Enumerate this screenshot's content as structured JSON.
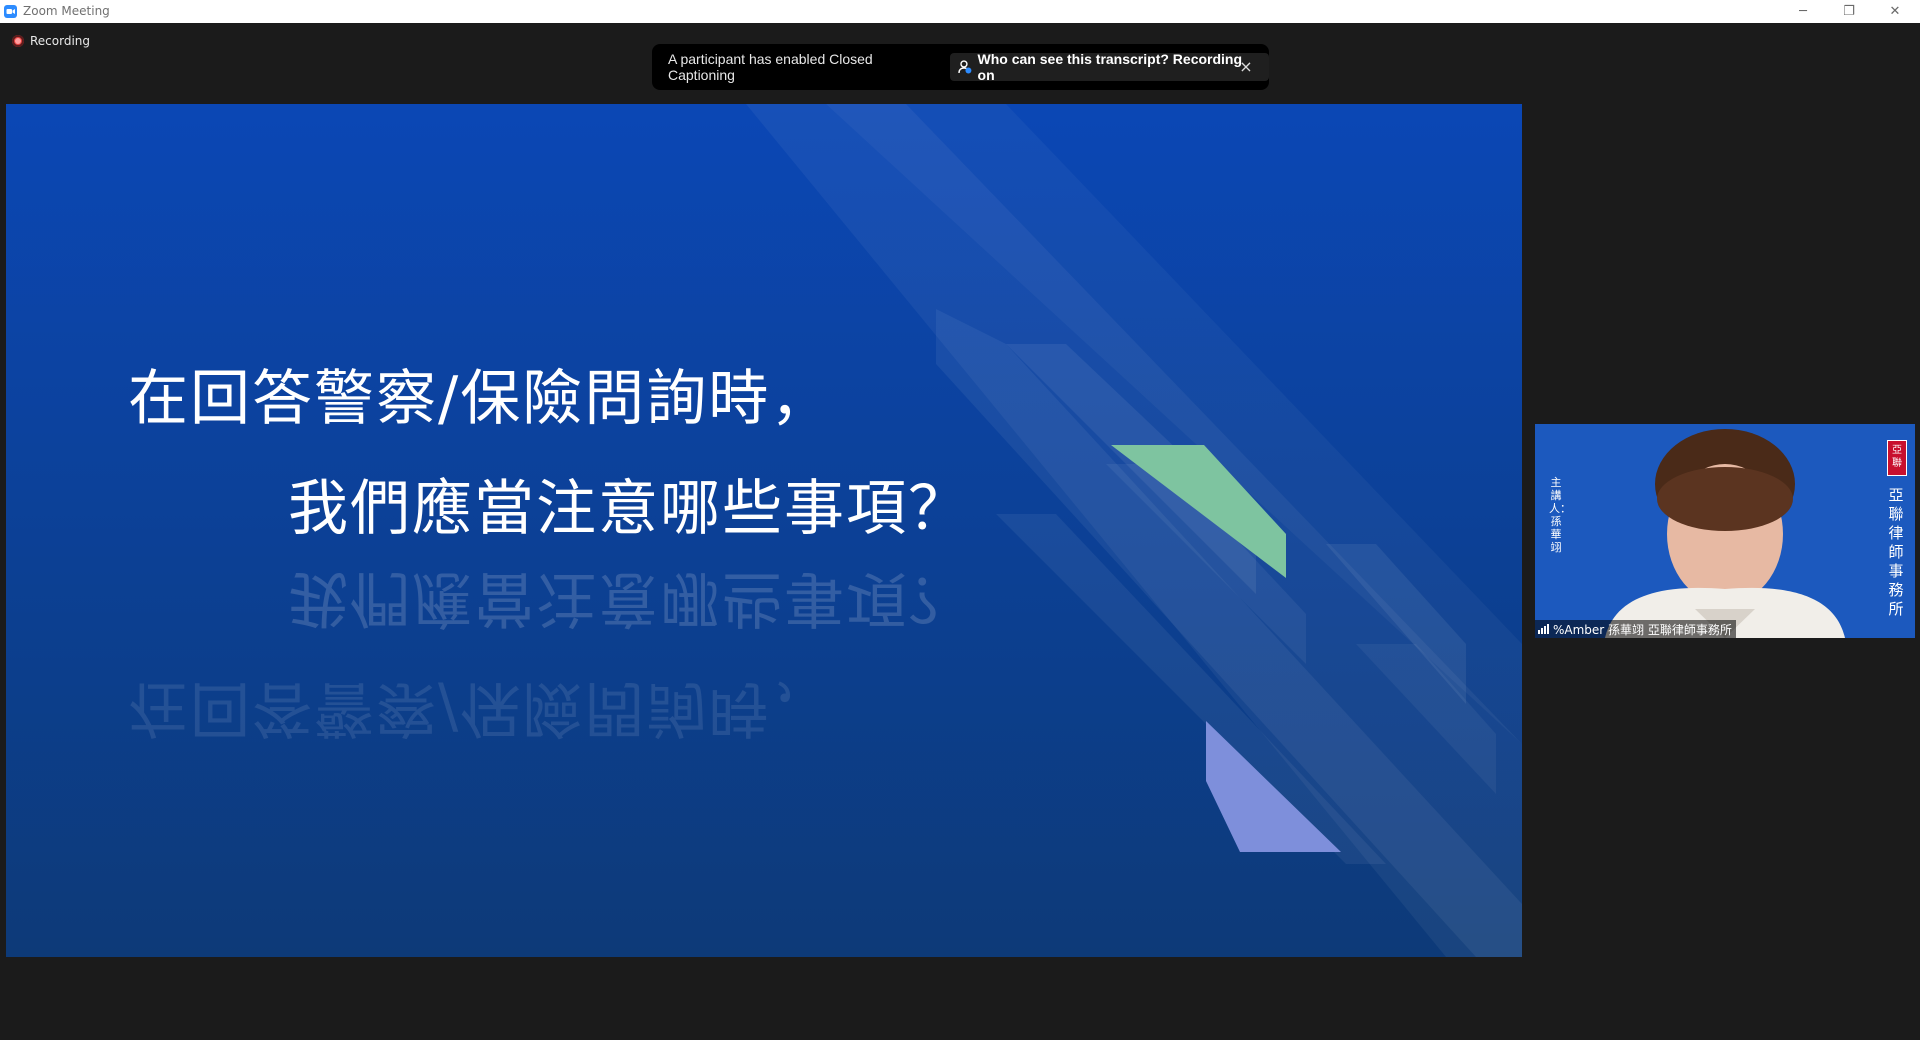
{
  "window": {
    "title": "Zoom Meeting",
    "minimize": "─",
    "restore": "❐",
    "close": "✕"
  },
  "recording": {
    "label": "Recording"
  },
  "banner": {
    "text": "A participant has enabled Closed Captioning",
    "pill_label": "Who can see this transcript? Recording on",
    "close": "×"
  },
  "slide": {
    "line1": "在回答警察/保險問詢時，",
    "line2": "我們應當注意哪些事項？",
    "colors": {
      "bg_top": "#0b47b5",
      "bg_bottom": "#0d3a78",
      "green": "#7ec4a0",
      "lavender": "#7e8fdb"
    }
  },
  "video": {
    "name_label": "%Amber 孫華翊 亞聯律師事務所",
    "speaker_caption": "主講人：孫華翊",
    "firm_vertical": "亞聯律師事務所",
    "seal_text": "亞聯"
  }
}
